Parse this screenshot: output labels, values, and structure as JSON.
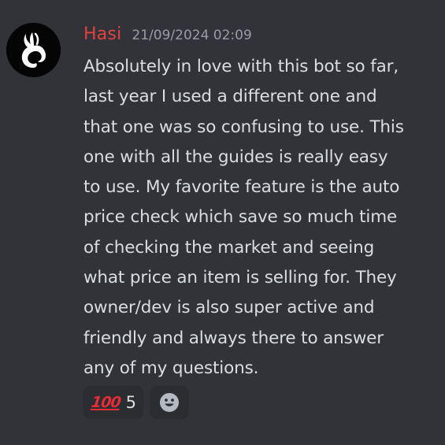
{
  "message": {
    "author": "Hasi",
    "timestamp": "21/09/2024 02:09",
    "lines": [
      "Absolutely in love with this bot so far,",
      "last year I used a different one and",
      "that one was so confusing to use. This",
      "one with all the guides is really easy",
      "to use. My favorite feature is the auto",
      "price check which save so much time",
      "of checking the market and seeing",
      "what price an item is selling for. They",
      "owner/dev is also super active and",
      "friendly and always there to answer",
      "any of my questions."
    ],
    "reactions": [
      {
        "emoji": "💯",
        "emoji_text": "100",
        "emoji_name": "hundred-points-icon",
        "count": "5"
      }
    ],
    "add_reaction_icon": "smile-face-icon"
  },
  "colors": {
    "background": "#313338",
    "username": "#e34242",
    "timestamp": "#9b9ca3",
    "text": "#dbdee1",
    "reaction_bg": "#2b2d31"
  }
}
